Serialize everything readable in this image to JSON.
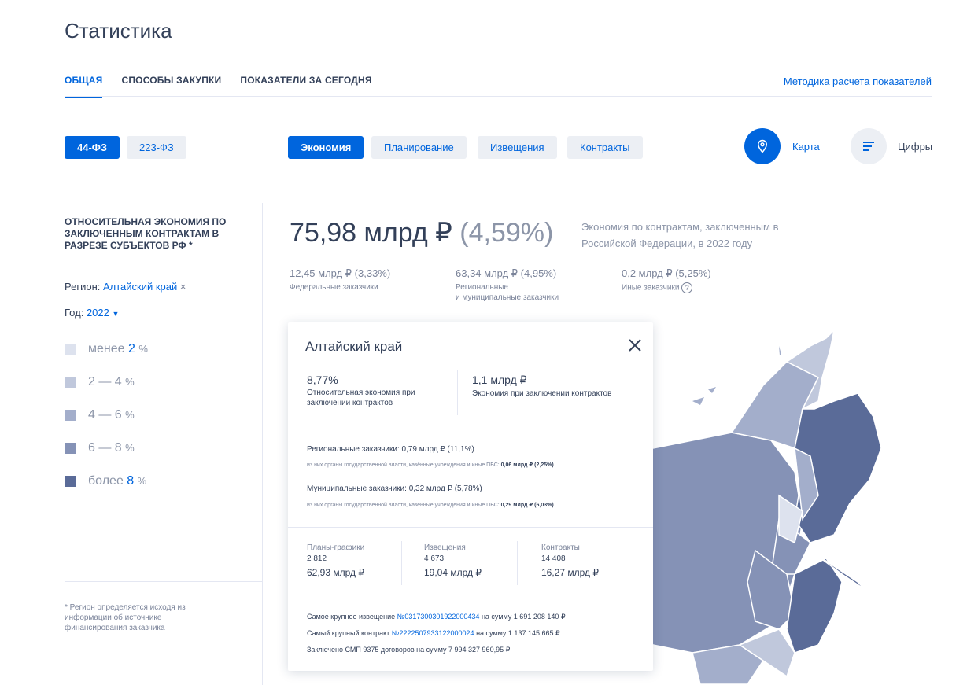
{
  "page_title": "Статистика",
  "tabs": [
    {
      "label": "ОБЩАЯ",
      "active": true
    },
    {
      "label": "СПОСОБЫ ЗАКУПКИ",
      "active": false
    },
    {
      "label": "ПОКАЗАТЕЛИ ЗА СЕГОДНЯ",
      "active": false
    }
  ],
  "method_link": "Методика расчета показателей",
  "law_buttons": [
    {
      "label": "44-ФЗ",
      "active": true
    },
    {
      "label": "223-ФЗ",
      "active": false
    }
  ],
  "metric_buttons": [
    {
      "label": "Экономия",
      "active": true
    },
    {
      "label": "Планирование",
      "active": false
    },
    {
      "label": "Извещения",
      "active": false
    },
    {
      "label": "Контракты",
      "active": false
    }
  ],
  "view_toggle": {
    "map_label": "Карта",
    "numbers_label": "Цифры"
  },
  "sidebar": {
    "section_title": "ОТНОСИТЕЛЬНАЯ ЭКОНОМИЯ ПО ЗАКЛЮЧЕННЫМ КОНТРАКТАМ В РАЗРЕЗЕ СУБЪЕКТОВ РФ *",
    "region_label": "Регион:",
    "region_value": "Алтайский край",
    "region_clear": "×",
    "year_label": "Год:",
    "year_value": "2022",
    "legend": [
      {
        "prefix": "менее",
        "value": "2",
        "unit": "%",
        "color": "#dde2ee"
      },
      {
        "prefix": "2 — 4",
        "value": "",
        "unit": "%",
        "color": "#c0c8dc"
      },
      {
        "prefix": "4 — 6",
        "value": "",
        "unit": "%",
        "color": "#a3aecb"
      },
      {
        "prefix": "6 — 8",
        "value": "",
        "unit": "%",
        "color": "#8592b6"
      },
      {
        "prefix": "более",
        "value": "8",
        "unit": "%",
        "color": "#5a6b98"
      }
    ],
    "footnote": "* Регион определяется исходя из информации об источнике финансирования заказчика"
  },
  "summary": {
    "value": "75,98 млрд ₽",
    "percent": "(4,59%)",
    "description": "Экономия по контрактам, заключенным в Российской Федерации, в 2022 году",
    "breakdown": [
      {
        "value": "12,45 млрд ₽ (3,33%)",
        "label_lines": [
          "Федеральные заказчики"
        ]
      },
      {
        "value": "63,34 млрд ₽ (4,95%)",
        "label_lines": [
          "Региональные",
          "и муниципальные заказчики"
        ]
      },
      {
        "value": "0,2 млрд ₽ (5,25%)",
        "label_lines": [
          "Иные заказчики"
        ],
        "help": "?"
      }
    ]
  },
  "popup": {
    "title": "Алтайский край",
    "kpis": [
      {
        "value": "8,77%",
        "label": "Относительная экономия при заключении контрактов"
      },
      {
        "value": "1,1 млрд ₽",
        "label": "Экономия при заключении контрактов"
      }
    ],
    "regional": {
      "line": "Региональные заказчики: 0,79 млрд ₽ (11,1%)",
      "sub_text": "из них органы государственной власти, казённые учреждения и иные ПБС:",
      "sub_value": "0,06 млрд ₽ (2,25%)"
    },
    "municipal": {
      "line": "Муниципальные заказчики: 0,32 млрд ₽ (5,78%)",
      "sub_text": "из них органы государственной власти, казённые учреждения и иные ПБС:",
      "sub_value": "0,29 млрд ₽ (6,03%)"
    },
    "columns": [
      {
        "label": "Планы-графики",
        "count": "2 812",
        "amount": "62,93 млрд ₽"
      },
      {
        "label": "Извещения",
        "count": "4 673",
        "amount": "19,04 млрд ₽"
      },
      {
        "label": "Контракты",
        "count": "14 408",
        "amount": "16,27 млрд ₽"
      }
    ],
    "largest_notice": {
      "prefix": "Самое крупное извещение",
      "number": "№0317300301922000434",
      "suffix": "на сумму 1 691 208 140 ₽"
    },
    "largest_contract": {
      "prefix": "Самый крупный контракт",
      "number": "№2222507933122000024",
      "suffix": "на сумму 1 137 145 665 ₽"
    },
    "smp": "Заключено СМП 9375 договоров на сумму 7 994 327 960,95 ₽"
  }
}
